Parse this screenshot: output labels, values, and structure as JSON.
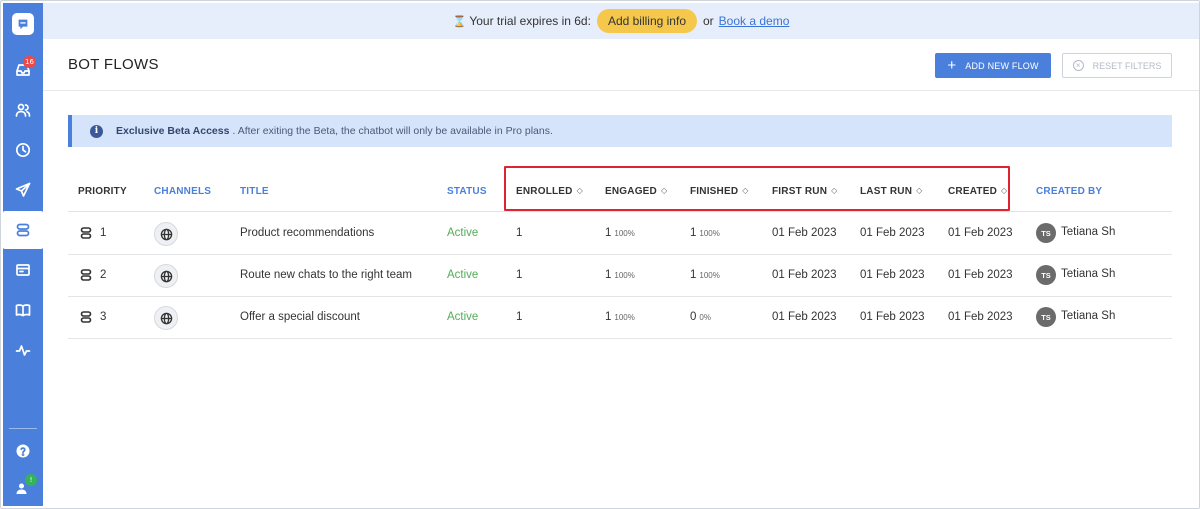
{
  "banner": {
    "trial_text": "Your trial expires in 6d:",
    "billing_label": "Add billing info",
    "or_text": "or",
    "demo_label": "Book a demo"
  },
  "sidebar": {
    "inbox_badge": "16",
    "team_badge": "!",
    "items": [
      {
        "icon": "chat-logo-icon"
      },
      {
        "icon": "inbox-icon"
      },
      {
        "icon": "users-icon"
      },
      {
        "icon": "clock-icon"
      },
      {
        "icon": "send-icon"
      },
      {
        "icon": "bot-flows-icon",
        "active": true
      },
      {
        "icon": "card-icon"
      },
      {
        "icon": "book-icon"
      },
      {
        "icon": "activity-icon"
      },
      {
        "icon": "help-icon"
      },
      {
        "icon": "team-icon"
      }
    ]
  },
  "header": {
    "title": "BOT FLOWS",
    "add_label": "ADD NEW FLOW",
    "reset_label": "RESET FILTERS"
  },
  "info": {
    "bold": "Exclusive Beta Access",
    "text": ". After exiting the Beta, the chatbot will only be available in Pro plans."
  },
  "table": {
    "columns": {
      "priority": "PRIORITY",
      "channels": "CHANNELS",
      "title": "TITLE",
      "status": "STATUS",
      "enrolled": "ENROLLED",
      "engaged": "ENGAGED",
      "finished": "FINISHED",
      "first_run": "FIRST RUN",
      "last_run": "LAST RUN",
      "created": "CREATED",
      "created_by": "CREATED BY"
    },
    "rows": [
      {
        "priority": "1",
        "title": "Product recommendations",
        "status": "Active",
        "enrolled": "1",
        "engaged": "1",
        "engaged_pct": "100%",
        "finished": "1",
        "finished_pct": "100%",
        "first_run": "01 Feb 2023",
        "last_run": "01 Feb 2023",
        "created": "01 Feb 2023",
        "initials": "TS",
        "creator": "Tetiana Sh"
      },
      {
        "priority": "2",
        "title": "Route new chats to the right team",
        "status": "Active",
        "enrolled": "1",
        "engaged": "1",
        "engaged_pct": "100%",
        "finished": "1",
        "finished_pct": "100%",
        "first_run": "01 Feb 2023",
        "last_run": "01 Feb 2023",
        "created": "01 Feb 2023",
        "initials": "TS",
        "creator": "Tetiana Sh"
      },
      {
        "priority": "3",
        "title": "Offer a special discount",
        "status": "Active",
        "enrolled": "1",
        "engaged": "1",
        "engaged_pct": "100%",
        "finished": "0",
        "finished_pct": "0%",
        "first_run": "01 Feb 2023",
        "last_run": "01 Feb 2023",
        "created": "01 Feb 2023",
        "initials": "TS",
        "creator": "Tetiana Sh"
      }
    ]
  },
  "colors": {
    "accent": "#4a80dc",
    "active_status": "#4fae58",
    "billing": "#f5c84c",
    "highlight": "#e0242e"
  }
}
